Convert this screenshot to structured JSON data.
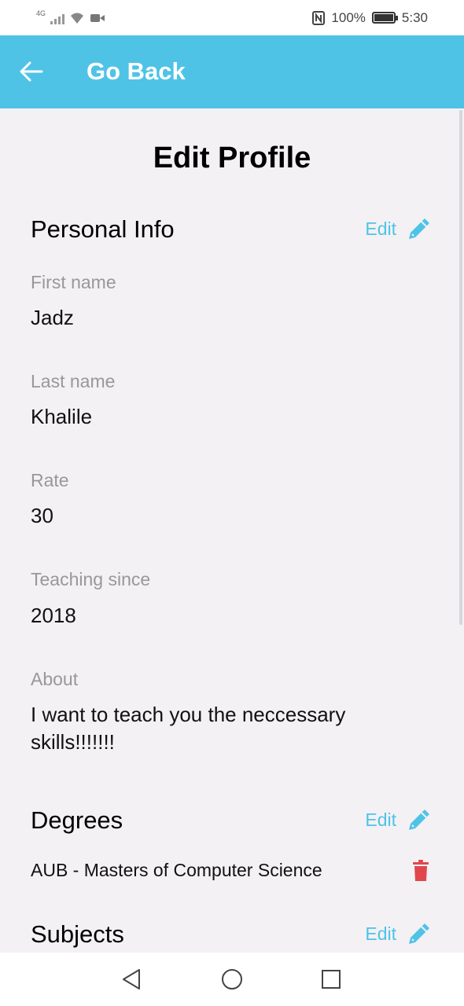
{
  "status_bar": {
    "network_tag": "4G",
    "battery_percent": "100%",
    "time": "5:30"
  },
  "app_bar": {
    "back_icon": "arrow-left-icon",
    "title": "Go Back"
  },
  "page": {
    "title": "Edit Profile"
  },
  "personal_info": {
    "heading": "Personal Info",
    "edit_label": "Edit",
    "fields": [
      {
        "label": "First name",
        "value": "Jadz"
      },
      {
        "label": "Last name",
        "value": "Khalile"
      },
      {
        "label": "Rate",
        "value": "30"
      },
      {
        "label": "Teaching since",
        "value": "2018"
      },
      {
        "label": "About",
        "value": "I want to teach you the neccessary skills!!!!!!!"
      }
    ]
  },
  "degrees": {
    "heading": "Degrees",
    "edit_label": "Edit",
    "items": [
      "AUB - Masters of Computer Science"
    ]
  },
  "subjects": {
    "heading": "Subjects",
    "edit_label": "Edit"
  },
  "colors": {
    "accent": "#4fc3e6",
    "delete": "#e0474c",
    "background": "#f3f1f4"
  }
}
